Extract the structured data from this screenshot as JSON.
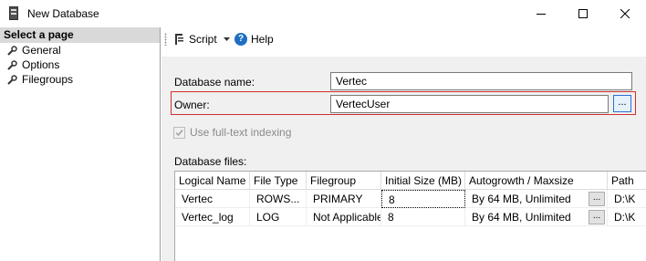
{
  "window": {
    "title": "New Database"
  },
  "sidebar": {
    "header": "Select a page",
    "items": [
      {
        "label": "General",
        "icon": "wrench-icon"
      },
      {
        "label": "Options",
        "icon": "wrench-icon"
      },
      {
        "label": "Filegroups",
        "icon": "wrench-icon"
      }
    ]
  },
  "toolbar": {
    "script_label": "Script",
    "help_label": "Help"
  },
  "form": {
    "database_name_label": "Database name:",
    "database_name_value": "Vertec",
    "owner_label": "Owner:",
    "owner_value": "VertecUser",
    "browse_label": "...",
    "fulltext_label": "Use full-text indexing",
    "fulltext_checked": true,
    "files_label": "Database files:"
  },
  "files_table": {
    "columns": [
      "Logical Name",
      "File Type",
      "Filegroup",
      "Initial Size (MB)",
      "Autogrowth / Maxsize",
      "Path"
    ],
    "rows": [
      [
        "Vertec",
        "ROWS...",
        "PRIMARY",
        "8",
        "By 64 MB, Unlimited",
        "D:\\K"
      ],
      [
        "Vertec_log",
        "LOG",
        "Not Applicable",
        "8",
        "By 64 MB, Unlimited",
        "D:\\K"
      ]
    ],
    "cell_button_label": "..."
  },
  "colors": {
    "highlight_border": "#d22d2d",
    "help_blue": "#1e6fc2",
    "pane_bg": "#f0f0f0"
  }
}
